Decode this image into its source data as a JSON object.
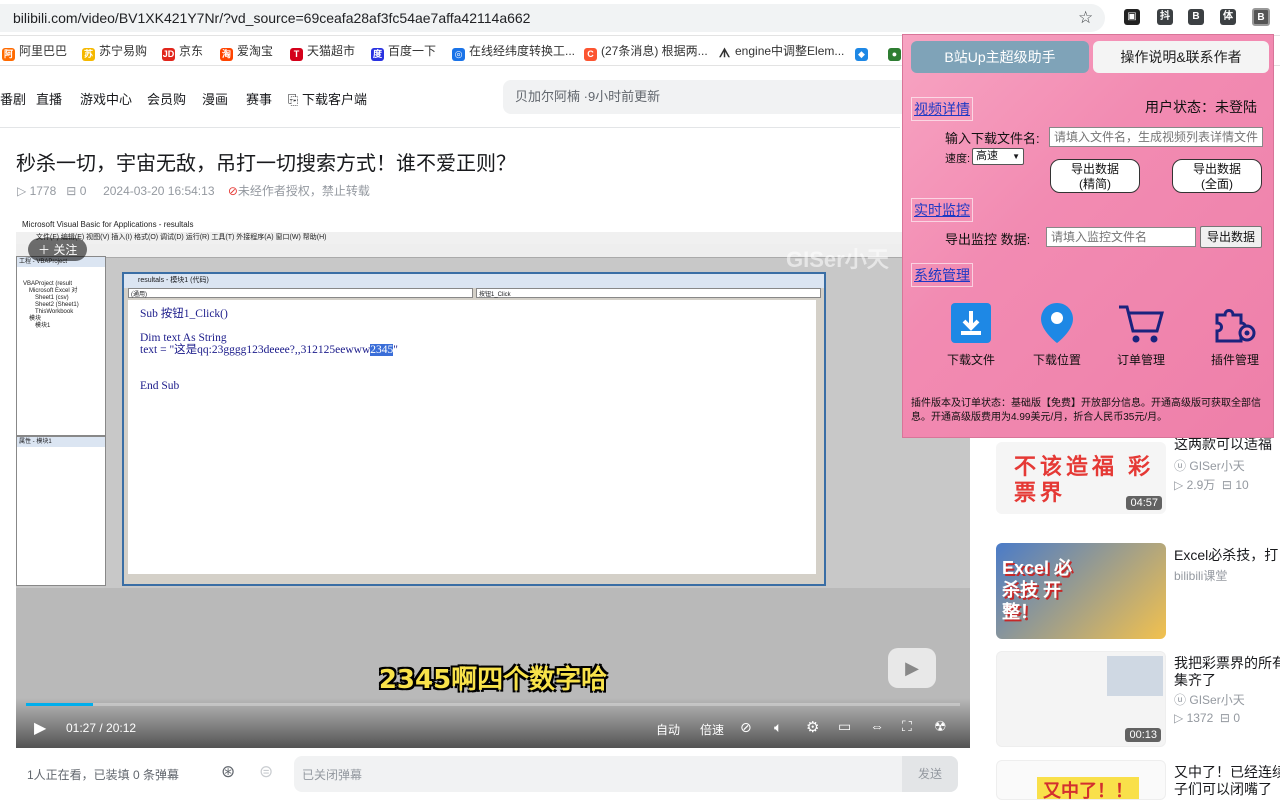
{
  "browser": {
    "url": "bilibili.com/video/BV1XK421Y7Nr/?vd_source=69ceafa28af3fc54ae7affa42114a662",
    "extensions": [
      "抖",
      "B",
      "体",
      "B"
    ]
  },
  "bookmarks": [
    {
      "label": "阿里巴巴",
      "icon": "alibaba-icon",
      "color": "#ff6a00"
    },
    {
      "label": "苏宁易购",
      "icon": "suning-icon",
      "color": "#f5b800"
    },
    {
      "label": "京东",
      "icon": "jd-icon",
      "color": "#e1251b"
    },
    {
      "label": "爱淘宝",
      "icon": "taobao-icon",
      "color": "#ff4400"
    },
    {
      "label": "天猫超市",
      "icon": "tmall-icon",
      "color": "#d4001a"
    },
    {
      "label": "百度一下",
      "icon": "baidu-icon",
      "color": "#2932e1"
    },
    {
      "label": "在线经纬度转换工...",
      "icon": "globe-icon",
      "color": "#1a73e8"
    },
    {
      "label": "(27条消息) 根据两...",
      "icon": "csdn-icon",
      "color": "#fc5531"
    },
    {
      "label": "engine中调整Elem...",
      "icon": "link-icon",
      "color": "#555555"
    }
  ],
  "nav": {
    "items": [
      "番剧",
      "直播",
      "游戏中心",
      "会员购",
      "漫画",
      "赛事",
      "下载客户端"
    ],
    "search_placeholder": "贝加尔阿楠 ·9小时前更新"
  },
  "video": {
    "title": "秒杀一切，宇宙无敌，吊打一切搜索方式！谁不爱正则？",
    "plays": "1778",
    "danmaku_count": "0",
    "date": "2024-03-20 16:54:13",
    "copyright": "未经作者授权，禁止转载",
    "follow_label": "关注",
    "subtitle": "2345啊四个数字哈",
    "watermark": "GISer小天",
    "time_current": "01:27",
    "time_total": "20:12",
    "progress": 0.072,
    "controls": {
      "auto": "自动",
      "speed": "倍速"
    },
    "vba": {
      "window_title": "Microsoft Visual Basic for Applications - resultals",
      "menu": "文件(F)  编辑(E)  视图(V)  插入(I)  格式(O)  调试(D)  运行(R)  工具(T)  外接程序(A)  窗口(W)  帮助(H)",
      "code_title": "resultals - 模块1 (代码)",
      "dropdown_left": "(通用)",
      "dropdown_right": "按钮1_Click",
      "project_title": "工程 - VBAProject",
      "project_items": [
        "VBAProject (result",
        "Microsoft Excel 对",
        "Sheet1 (csv)",
        "Sheet2 (Sheet1)",
        "ThisWorkbook",
        "模块",
        "模块1"
      ],
      "props_title": "属性 - 模块1",
      "code_lines": [
        "Sub 按钮1_Click()",
        "",
        "Dim text As String",
        "text = \"这是qq:23gggg123deeee?,,312125eewww",
        "",
        "",
        "End Sub"
      ],
      "code_highlight": "2345",
      "code_tail": "\""
    }
  },
  "danmaku_bar": {
    "watching": "1人正在看，已装填 0 条弹幕",
    "placeholder": "已关闭弹幕",
    "send": "发送"
  },
  "recommendations": [
    {
      "title": "这两款可以适福",
      "author": "GISer小天",
      "plays": "2.9万",
      "danmaku": "10",
      "duration": "04:57",
      "thumb_text": "不该造福 彩票界"
    },
    {
      "title": "Excel必杀技，打",
      "author": "bilibili课堂",
      "plays": "",
      "danmaku": "",
      "duration": "",
      "thumb_text": "Excel 必杀技 开整！"
    },
    {
      "title": "我把彩票界的所有",
      "title2": "集齐了",
      "author": "GISer小天",
      "plays": "1372",
      "danmaku": "0",
      "duration": "00:13",
      "thumb_text": ""
    },
    {
      "title": "又中了！已经连续",
      "title2": "子们可以闭嘴了",
      "author": "",
      "plays": "",
      "danmaku": "",
      "duration": "",
      "thumb_text": "又中了！！"
    }
  ],
  "plugin": {
    "tabs": [
      "B站Up主超级助手",
      "操作说明&联系作者"
    ],
    "sections": {
      "detail": "视频详情",
      "monitor": "实时监控",
      "system": "系统管理"
    },
    "user_status": "用户状态：未登陆",
    "filename_label": "输入下载文件名:",
    "filename_placeholder": "请填入文件名，生成视频列表详情文件",
    "speed_label": "速度:",
    "speed_value": "高速",
    "export_simple": [
      "导出数据",
      "(精简)"
    ],
    "export_full": [
      "导出数据",
      "(全面)"
    ],
    "monitor_label": "导出监控 数据:",
    "monitor_placeholder": "请填入监控文件名",
    "monitor_button": "导出数据",
    "tools": [
      {
        "label": "下载文件",
        "icon": "download-icon",
        "color": "#1e88e5"
      },
      {
        "label": "下载位置",
        "icon": "location-pin-icon",
        "color": "#1e88e5"
      },
      {
        "label": "订单管理",
        "icon": "shopping-cart-icon",
        "color": "#1a237e"
      },
      {
        "label": "插件管理",
        "icon": "plugin-gear-icon",
        "color": "#1a237e"
      }
    ],
    "footer": "插件版本及订单状态：基础版【免费】开放部分信息。开通高级版可获取全部信息。开通高级版费用为4.99美元/月，折合人民币35元/月。"
  },
  "colors": {
    "accent": "#00aeec",
    "plugin_bg": "#f28bb2",
    "subtitle": "#f8e24a"
  }
}
